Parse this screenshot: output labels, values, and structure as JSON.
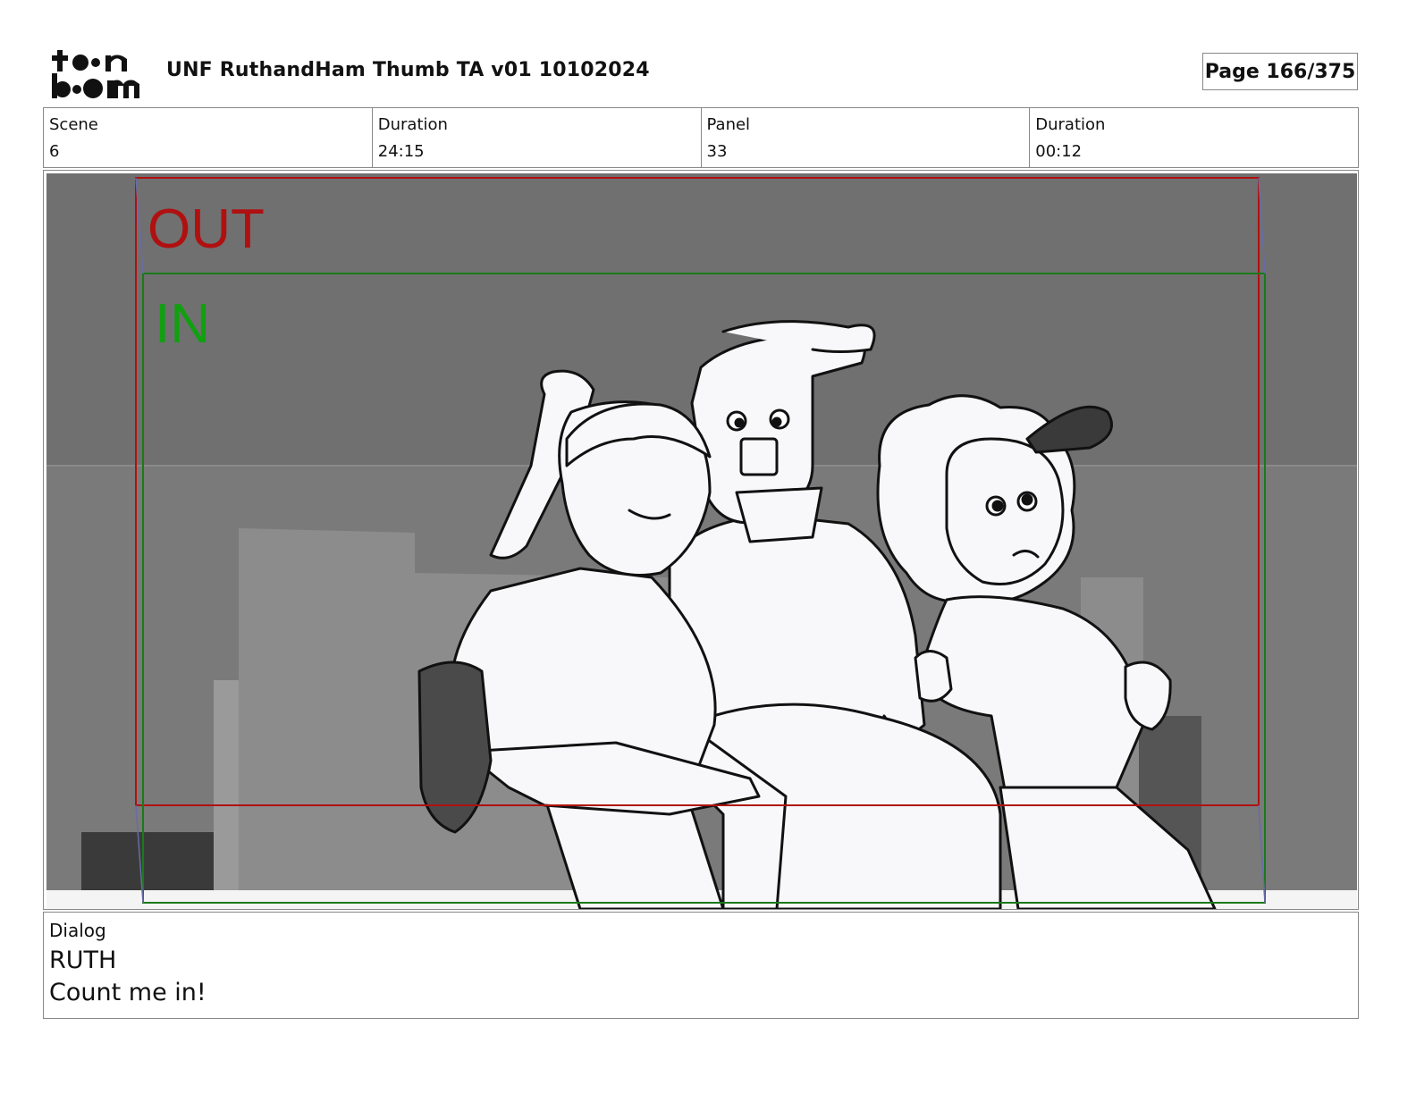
{
  "header": {
    "logo_text": "toon boom",
    "document_title": "UNF RuthandHam Thumb TA v01 10102024",
    "page_label": "Page 166/375"
  },
  "info": [
    {
      "label": "Scene",
      "value": "6"
    },
    {
      "label": "Duration",
      "value": "24:15"
    },
    {
      "label": "Panel",
      "value": "33"
    },
    {
      "label": "Duration",
      "value": "00:12"
    }
  ],
  "panel": {
    "out_label": "OUT",
    "in_label": "IN",
    "colors": {
      "out": "#b01010",
      "in": "#10a010",
      "in_frame": "#1a7a1a"
    }
  },
  "dialog": {
    "label": "Dialog",
    "character": "RUTH",
    "line": "Count me in!"
  }
}
